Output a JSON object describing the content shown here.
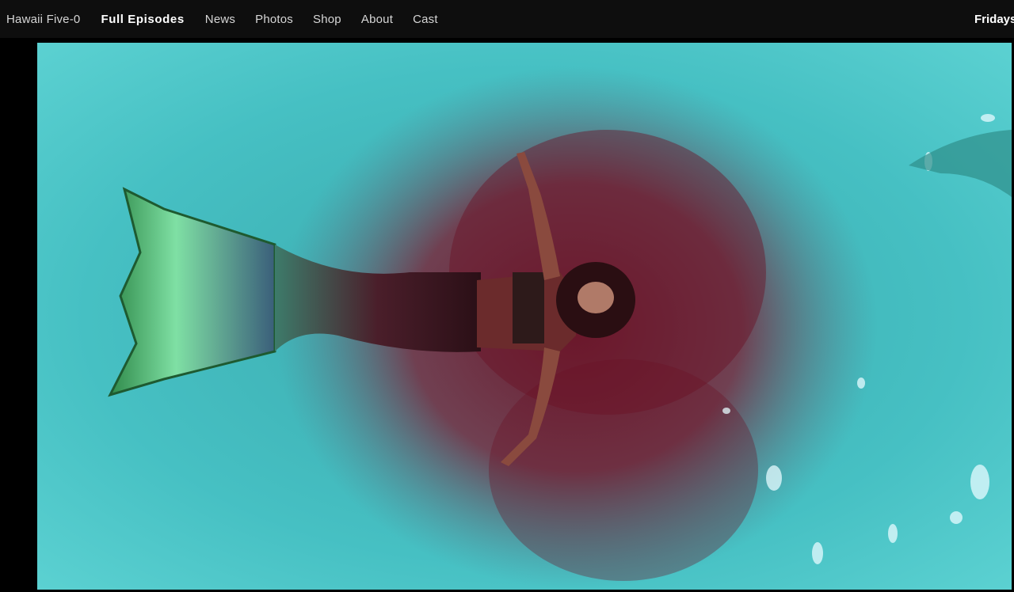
{
  "nav": {
    "brand": "Hawaii Five-0",
    "items": [
      {
        "id": "full-episodes",
        "label": "Full Episodes",
        "active": true
      },
      {
        "id": "news",
        "label": "News",
        "active": false
      },
      {
        "id": "photos",
        "label": "Photos",
        "active": false
      },
      {
        "id": "shop",
        "label": "Shop",
        "active": false
      },
      {
        "id": "about",
        "label": "About",
        "active": false
      },
      {
        "id": "cast",
        "label": "Cast",
        "active": false
      }
    ],
    "schedule": "Fridays"
  },
  "colors": {
    "nav_bg": "#0e0e0e",
    "water": "#4cc7c8",
    "blood": "#7a1a32",
    "tail": "#3fae7a"
  }
}
